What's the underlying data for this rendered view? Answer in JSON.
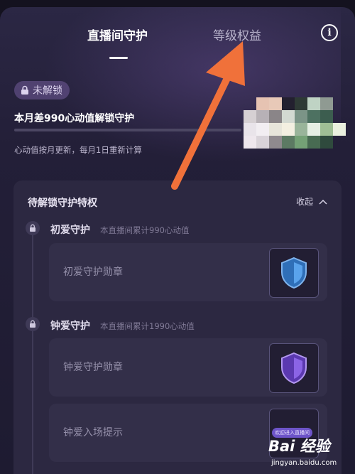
{
  "tabs": {
    "active": "直播间守护",
    "inactive": "等级权益"
  },
  "info_icon": "i",
  "badge": {
    "icon": "lock-icon",
    "label": "未解锁"
  },
  "goal_text": "本月差990心动值解锁守护",
  "progress": 0.0,
  "hint_text": "心动值按月更新，每月1日重新计算",
  "card": {
    "title": "待解锁守护特权",
    "collapse_label": "收起",
    "sections": [
      {
        "title": "初爱守护",
        "subtitle": "本直播间累计990心动值",
        "items": [
          {
            "label": "初爱守护勋章",
            "image": "blue-shield-icon"
          }
        ]
      },
      {
        "title": "钟爱守护",
        "subtitle": "本直播间累计1990心动值",
        "items": [
          {
            "label": "钟爱守护勋章",
            "image": "purple-shield-icon"
          },
          {
            "label": "钟爱入场提示",
            "image": "entry-banner",
            "banner_text": "欢迎进入直播间"
          }
        ]
      }
    ]
  },
  "watermark": {
    "brand": "Bai 经验",
    "url": "jingyan.baidu.com"
  },
  "colors": {
    "arrow": "#f0713a",
    "accent_purple": "#6d54c9",
    "shield_blue": "#3d86d8",
    "shield_purple": "#7a4fd4"
  }
}
